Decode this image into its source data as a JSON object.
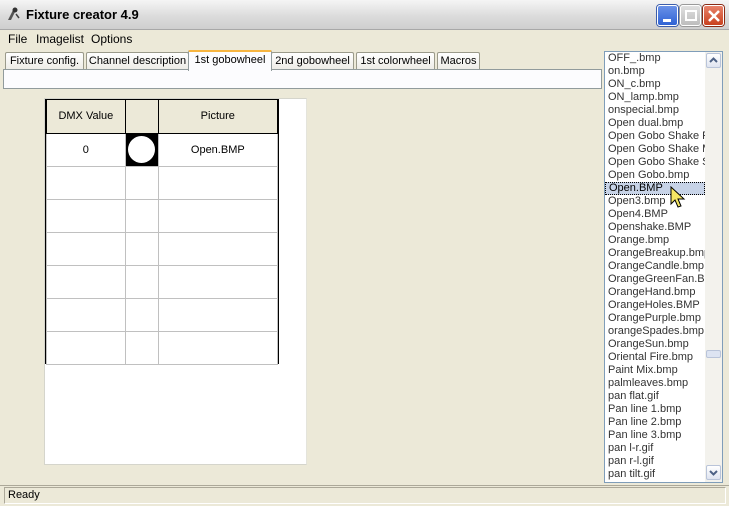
{
  "window": {
    "title": "Fixture creator 4.9"
  },
  "menu": [
    "File",
    "Imagelist",
    "Options"
  ],
  "tabs": [
    {
      "label": "Fixture config.",
      "active": false
    },
    {
      "label": "Channel description",
      "active": false
    },
    {
      "label": "1st gobowheel",
      "active": true
    },
    {
      "label": "2nd gobowheel",
      "active": false
    },
    {
      "label": "1st colorwheel",
      "active": false
    },
    {
      "label": "Macros",
      "active": false
    }
  ],
  "grid": {
    "headers": [
      "DMX Value",
      "",
      "Picture"
    ],
    "rows": [
      {
        "dmx": "0",
        "picture": "Open.BMP",
        "has_image": true
      },
      {
        "dmx": "",
        "picture": "",
        "has_image": false
      },
      {
        "dmx": "",
        "picture": "",
        "has_image": false
      },
      {
        "dmx": "",
        "picture": "",
        "has_image": false
      },
      {
        "dmx": "",
        "picture": "",
        "has_image": false
      },
      {
        "dmx": "",
        "picture": "",
        "has_image": false
      },
      {
        "dmx": "",
        "picture": "",
        "has_image": false
      }
    ]
  },
  "image_list": {
    "selected": "Open.BMP",
    "items": [
      "OFF_.bmp",
      "on.bmp",
      "ON_c.bmp",
      "ON_lamp.bmp",
      "onspecial.bmp",
      "Open dual.bmp",
      "Open Gobo Shake F",
      "Open Gobo Shake M",
      "Open Gobo Shake S",
      "Open Gobo.bmp",
      "Open.BMP",
      "Open3.bmp",
      "Open4.BMP",
      "Openshake.BMP",
      "Orange.bmp",
      "OrangeBreakup.bmp",
      "OrangeCandle.bmp",
      "OrangeGreenFan.BM",
      "OrangeHand.bmp",
      "OrangeHoles.BMP",
      "OrangePurple.bmp",
      "orangeSpades.bmp",
      "OrangeSun.bmp",
      "Oriental Fire.bmp",
      "Paint Mix.bmp",
      "palmleaves.bmp",
      "pan flat.gif",
      "Pan line 1.bmp",
      "Pan line 2.bmp",
      "Pan line 3.bmp",
      "pan l-r.gif",
      "pan r-l.gif",
      "pan tilt.gif"
    ]
  },
  "status": {
    "text": "Ready"
  },
  "colors": {
    "selection": "#c7d3e7",
    "tab_highlight": "#f7b540",
    "close_button": "#c9411f"
  }
}
